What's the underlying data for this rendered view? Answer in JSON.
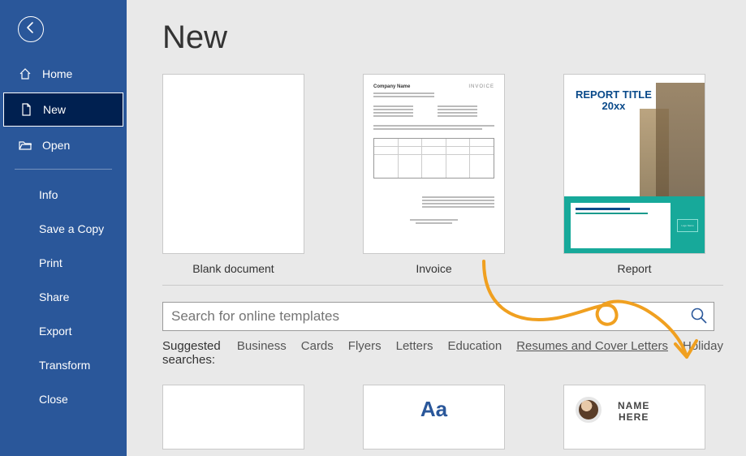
{
  "sidebar": {
    "primary": [
      {
        "label": "Home"
      },
      {
        "label": "New"
      },
      {
        "label": "Open"
      }
    ],
    "secondary": [
      {
        "label": "Info"
      },
      {
        "label": "Save a Copy"
      },
      {
        "label": "Print"
      },
      {
        "label": "Share"
      },
      {
        "label": "Export"
      },
      {
        "label": "Transform"
      },
      {
        "label": "Close"
      }
    ]
  },
  "page_title": "New",
  "templates": [
    {
      "label": "Blank document"
    },
    {
      "label": "Invoice"
    },
    {
      "label": "Report"
    }
  ],
  "invoice_thumb": {
    "company": "Company Name",
    "tag": "INVOICE"
  },
  "report_thumb": {
    "title_line1": "REPORT TITLE",
    "title_line2": "20xx",
    "logo_text": "Logo Name"
  },
  "search": {
    "placeholder": "Search for online templates"
  },
  "suggested": {
    "label": "Suggested searches:",
    "items": [
      "Business",
      "Cards",
      "Flyers",
      "Letters",
      "Education",
      "Resumes and Cover Letters",
      "Holiday"
    ],
    "underlined_index": 5
  },
  "row2": {
    "style_sample": "Aa",
    "resume_name_line1": "NAME",
    "resume_name_line2": "HERE"
  },
  "colors": {
    "sidebar": "#2a579a",
    "sidebar_selected": "#002050",
    "accent": "#2a579a",
    "annotation": "#f0a020",
    "report_teal": "#17a99a"
  }
}
